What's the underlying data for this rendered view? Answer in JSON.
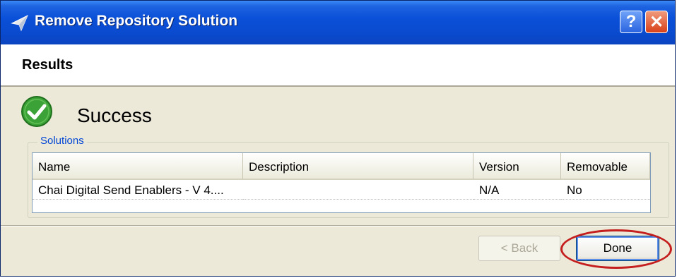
{
  "window": {
    "title": "Remove Repository Solution",
    "help_label": "?",
    "close_label": "✕"
  },
  "header": {
    "title": "Results"
  },
  "status": {
    "text": "Success",
    "icon": "check-circle-icon",
    "color": "#3aa236"
  },
  "solutions": {
    "legend": "Solutions",
    "columns": [
      "Name",
      "Description",
      "Version",
      "Removable"
    ],
    "rows": [
      {
        "name": "Chai Digital Send Enablers - V 4....",
        "description": "",
        "version": "N/A",
        "removable": "No"
      }
    ]
  },
  "buttons": {
    "back_label": "< Back",
    "done_label": "Done"
  },
  "annotation": {
    "highlight_color": "#c41e1e"
  }
}
